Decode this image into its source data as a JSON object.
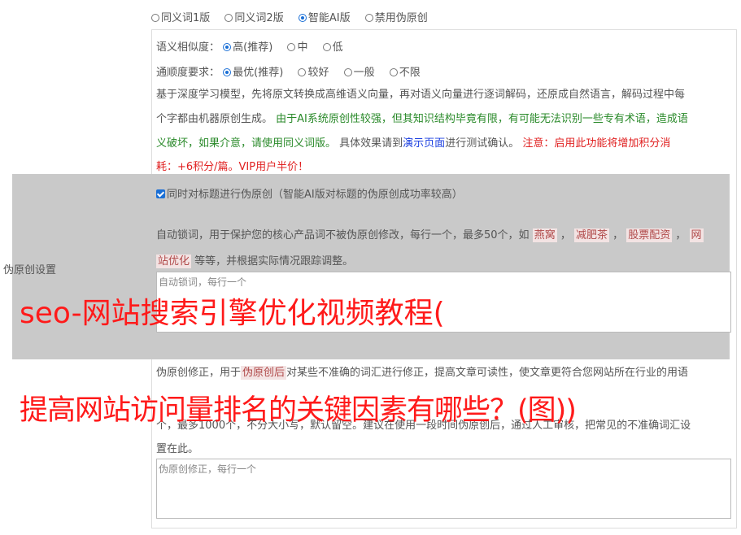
{
  "version_options": [
    {
      "label": "同义词1版",
      "selected": false
    },
    {
      "label": "同义词2版",
      "selected": false
    },
    {
      "label": "智能AI版",
      "selected": true
    },
    {
      "label": "禁用伪原创",
      "selected": false
    }
  ],
  "similarity": {
    "label": "语义相似度：",
    "options": [
      {
        "label": "高(推荐)",
        "selected": true
      },
      {
        "label": "中",
        "selected": false
      },
      {
        "label": "低",
        "selected": false
      }
    ]
  },
  "fluency": {
    "label": "通顺度要求：",
    "options": [
      {
        "label": "最优(推荐)",
        "selected": true
      },
      {
        "label": "较好",
        "selected": false
      },
      {
        "label": "一般",
        "selected": false
      },
      {
        "label": "不限",
        "selected": false
      }
    ]
  },
  "description": {
    "line1": "基于深度学习模型，先将原文转换成高维语义向量，再对语义向量进行逐词解码，还原成自然语言，解码过程中每",
    "line2_a": "个字都由机器原创生成。",
    "line2_b": "由于AI系统原创性较强，但其知识结构毕竟有限，有可能无法识别一些专有术语，造成语",
    "line3_a": "义破坏，如果介意，请使用同义词版。",
    "line3_b": "具体效果请到",
    "line3_link": "演示页面",
    "line3_c": "进行测试确认。",
    "line3_d": "注意：启用此功能将增加积分消",
    "line4": "耗：+6积分/篇。VIP用户半价！"
  },
  "section_label": "伪原创设置",
  "title_checkbox": "同时对标题进行伪原创（智能AI版对标题的伪原创成功率较高）",
  "lock_words": {
    "line1_a": "自动锁词，用于保护您的核心产品词不被伪原创修改，每行一个，最多50个，如",
    "tags": [
      "燕窝",
      "减肥茶",
      "股票配资",
      "网"
    ],
    "line2_tag": "站优化",
    "line2_b": "等等，并根据实际情况跟踪调整。",
    "placeholder": "自动锁词，每行一个"
  },
  "correction": {
    "line1_a": "伪原创修正，用于",
    "tag": "伪原创后",
    "line1_b": "对某些不准确的词汇进行修正，提高文章可读性，使文章更符合您网站所在行业的用语",
    "line3": "个，最多1000个，不分大小写，默认留空。建议在使用一段时间伪原创后，通过人工审核，把常见的不准确词汇设",
    "line4": "置在此。",
    "placeholder": "伪原创修正，每行一个"
  },
  "overlay": {
    "title1": "seo-网站搜索引擎优化视频教程(",
    "title2": "提高网站访问量排名的关键因素有哪些？(图))"
  }
}
